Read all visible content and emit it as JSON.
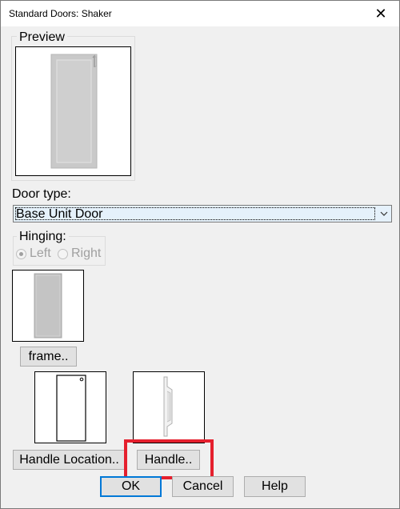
{
  "window": {
    "title": "Standard Doors: Shaker",
    "close_glyph": "✕"
  },
  "preview": {
    "legend": "Preview"
  },
  "door_type": {
    "label": "Door type:",
    "selected": "Base Unit Door"
  },
  "hinging": {
    "legend": "Hinging:",
    "left": "Left",
    "right": "Right",
    "selected": "Left"
  },
  "buttons": {
    "frame": "frame..",
    "handle_location": "Handle Location..",
    "handle": "Handle..",
    "ok": "OK",
    "cancel": "Cancel",
    "help": "Help"
  },
  "icons": {
    "close": "close-icon",
    "dropdown": "chevron-down-icon"
  },
  "colors": {
    "highlight": "#e5202e",
    "focus": "#0078d7",
    "select_bg": "#e5f1fb"
  }
}
